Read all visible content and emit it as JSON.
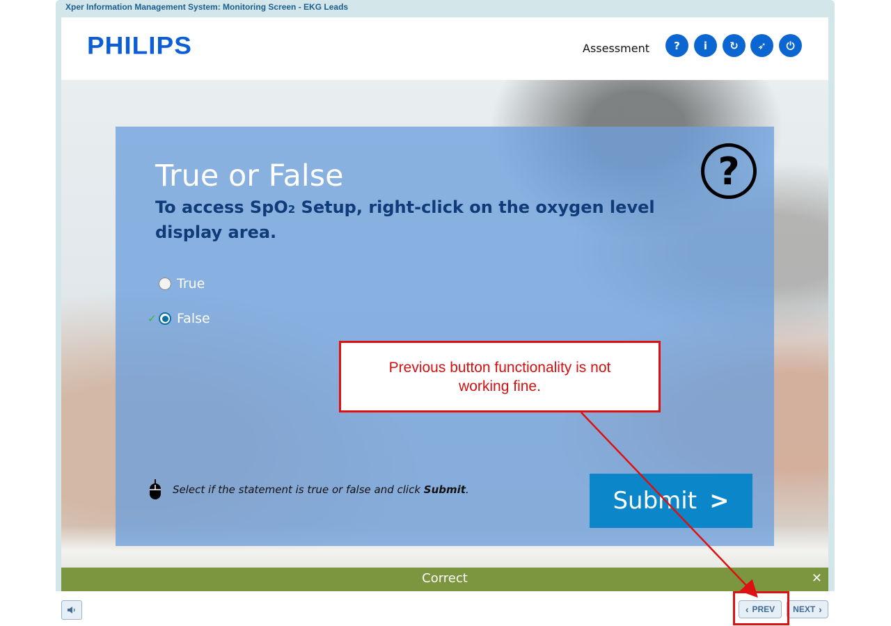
{
  "window": {
    "title": "Xper Information Management System: Monitoring Screen - EKG Leads"
  },
  "header": {
    "logo": "PHILIPS",
    "section": "Assessment",
    "buttons": [
      {
        "icon": "help-icon",
        "glyph": "?"
      },
      {
        "icon": "info-icon",
        "glyph": "i"
      },
      {
        "icon": "refresh-icon",
        "glyph": "↻"
      },
      {
        "icon": "compass-icon",
        "glyph": "➶"
      },
      {
        "icon": "power-icon",
        "glyph": "⏻"
      }
    ]
  },
  "question": {
    "title": "True or False",
    "text_before": "To access SpO",
    "text_sub": "2",
    "text_after": " Setup, right-click on the oxygen level display area.",
    "icon": "question-mark-icon",
    "options": [
      {
        "label": "True",
        "selected": false
      },
      {
        "label": "False",
        "selected": true,
        "marked_correct": true
      }
    ],
    "instruction_before": "Select if the statement is true or false and click ",
    "instruction_bold": "Submit",
    "instruction_after": ".",
    "submit_label": "Submit",
    "submit_glyph": ">"
  },
  "feedback": {
    "text": "Correct",
    "close_glyph": "✕"
  },
  "navigation": {
    "prev_label": "PREV",
    "next_label": "NEXT",
    "prev_glyph": "‹",
    "next_glyph": "›"
  },
  "annotation": {
    "text": "Previous button functionality is not working fine.",
    "color": "#dd1111"
  },
  "colors": {
    "brand_blue": "#0b66d2",
    "submit_blue": "#0b86c9",
    "feedback_green": "#7b963e",
    "question_text": "#0f3b78"
  }
}
